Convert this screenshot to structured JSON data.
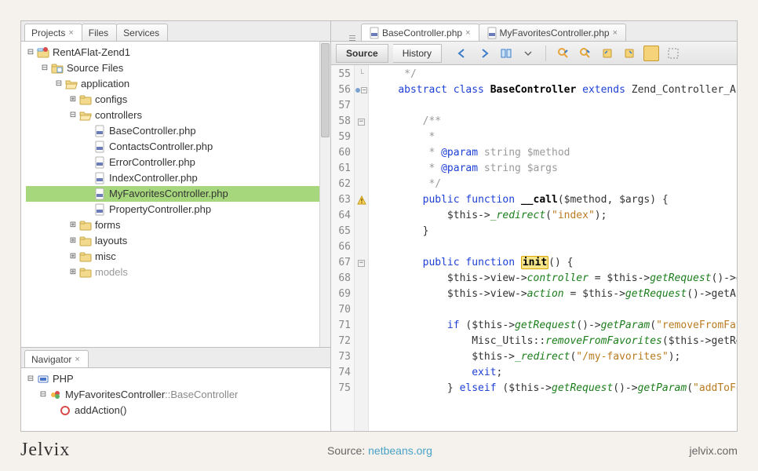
{
  "projects_panel": {
    "tabs": [
      {
        "label": "Projects",
        "active": true,
        "closable": true
      },
      {
        "label": "Files",
        "active": false,
        "closable": false
      },
      {
        "label": "Services",
        "active": false,
        "closable": false
      }
    ],
    "tree": [
      {
        "depth": 0,
        "expand": "minus",
        "icon": "project-icon",
        "label": "RentAFlat-Zend1"
      },
      {
        "depth": 1,
        "expand": "minus",
        "icon": "folder-source-icon",
        "label": "Source Files"
      },
      {
        "depth": 2,
        "expand": "minus",
        "icon": "folder-open-icon",
        "label": "application"
      },
      {
        "depth": 3,
        "expand": "plus",
        "icon": "folder-icon",
        "label": "configs"
      },
      {
        "depth": 3,
        "expand": "minus",
        "icon": "folder-open-icon",
        "label": "controllers"
      },
      {
        "depth": 4,
        "expand": "none",
        "icon": "php-file-icon",
        "label": "BaseController.php"
      },
      {
        "depth": 4,
        "expand": "none",
        "icon": "php-file-icon",
        "label": "ContactsController.php"
      },
      {
        "depth": 4,
        "expand": "none",
        "icon": "php-file-icon",
        "label": "ErrorController.php"
      },
      {
        "depth": 4,
        "expand": "none",
        "icon": "php-file-icon",
        "label": "IndexController.php"
      },
      {
        "depth": 4,
        "expand": "none",
        "icon": "php-file-icon",
        "label": "MyFavoritesController.php",
        "selected": true
      },
      {
        "depth": 4,
        "expand": "none",
        "icon": "php-file-icon",
        "label": "PropertyController.php"
      },
      {
        "depth": 3,
        "expand": "plus",
        "icon": "folder-icon",
        "label": "forms"
      },
      {
        "depth": 3,
        "expand": "plus",
        "icon": "folder-icon",
        "label": "layouts"
      },
      {
        "depth": 3,
        "expand": "plus",
        "icon": "folder-icon",
        "label": "misc"
      },
      {
        "depth": 3,
        "expand": "plus",
        "icon": "folder-icon",
        "label": "models",
        "cut": true
      }
    ]
  },
  "navigator_panel": {
    "tab_label": "Navigator",
    "root_label": "PHP",
    "class_name": "MyFavoritesController",
    "class_sep": "::",
    "class_base": "BaseController",
    "members": [
      "addAction()"
    ]
  },
  "editor": {
    "tabs": [
      {
        "icon": "php-file-icon",
        "label": "BaseController.php",
        "active": true
      },
      {
        "icon": "php-file-icon",
        "label": "MyFavoritesController.php",
        "active": false
      }
    ],
    "toolbar": {
      "source_label": "Source",
      "history_label": "History"
    },
    "line_start": 55,
    "glyphs": {
      "55": "fold-end",
      "56": "bullet-fold",
      "58": "fold-open",
      "63": "warning",
      "67": "fold-open"
    },
    "lines": [
      {
        "n": 55,
        "segs": [
          {
            "t": "     ",
            "c": ""
          },
          {
            "t": "*/",
            "c": "cm"
          }
        ]
      },
      {
        "n": 56,
        "segs": [
          {
            "t": "    ",
            "c": ""
          },
          {
            "t": "abstract class",
            "c": "kw"
          },
          {
            "t": " ",
            "c": ""
          },
          {
            "t": "BaseController",
            "c": "bold"
          },
          {
            "t": " ",
            "c": ""
          },
          {
            "t": "extends",
            "c": "kw"
          },
          {
            "t": " Zend_Controller_Ac",
            "c": ""
          }
        ]
      },
      {
        "n": 57,
        "segs": [
          {
            "t": " ",
            "c": ""
          }
        ]
      },
      {
        "n": 58,
        "segs": [
          {
            "t": "        ",
            "c": ""
          },
          {
            "t": "/**",
            "c": "cm"
          }
        ]
      },
      {
        "n": 59,
        "segs": [
          {
            "t": "         ",
            "c": ""
          },
          {
            "t": "*",
            "c": "cm"
          }
        ]
      },
      {
        "n": 60,
        "segs": [
          {
            "t": "         ",
            "c": ""
          },
          {
            "t": "* ",
            "c": "cm"
          },
          {
            "t": "@param",
            "c": "kw"
          },
          {
            "t": " string $method",
            "c": "cm"
          }
        ]
      },
      {
        "n": 61,
        "segs": [
          {
            "t": "         ",
            "c": ""
          },
          {
            "t": "* ",
            "c": "cm"
          },
          {
            "t": "@param",
            "c": "kw"
          },
          {
            "t": " string $args",
            "c": "cm"
          }
        ]
      },
      {
        "n": 62,
        "segs": [
          {
            "t": "         ",
            "c": ""
          },
          {
            "t": "*/",
            "c": "cm"
          }
        ]
      },
      {
        "n": 63,
        "segs": [
          {
            "t": "        ",
            "c": ""
          },
          {
            "t": "public function",
            "c": "kw"
          },
          {
            "t": " ",
            "c": ""
          },
          {
            "t": "__call",
            "c": "bold"
          },
          {
            "t": "($method, $args) {",
            "c": ""
          }
        ]
      },
      {
        "n": 64,
        "segs": [
          {
            "t": "            $this->",
            "c": ""
          },
          {
            "t": "_redirect",
            "c": "fn"
          },
          {
            "t": "(",
            "c": ""
          },
          {
            "t": "\"index\"",
            "c": "str"
          },
          {
            "t": ");",
            "c": ""
          }
        ]
      },
      {
        "n": 65,
        "segs": [
          {
            "t": "        }",
            "c": ""
          }
        ]
      },
      {
        "n": 66,
        "segs": [
          {
            "t": " ",
            "c": ""
          }
        ]
      },
      {
        "n": 67,
        "segs": [
          {
            "t": "        ",
            "c": ""
          },
          {
            "t": "public function",
            "c": "kw"
          },
          {
            "t": " ",
            "c": ""
          },
          {
            "t": "init",
            "c": "hl-word bold"
          },
          {
            "t": "() {",
            "c": ""
          }
        ]
      },
      {
        "n": 68,
        "segs": [
          {
            "t": "            $this->view->",
            "c": ""
          },
          {
            "t": "controller",
            "c": "fn"
          },
          {
            "t": " = $this->",
            "c": ""
          },
          {
            "t": "getRequest",
            "c": "fn"
          },
          {
            "t": "()->g",
            "c": ""
          }
        ]
      },
      {
        "n": 69,
        "segs": [
          {
            "t": "            $this->view->",
            "c": ""
          },
          {
            "t": "action",
            "c": "fn"
          },
          {
            "t": " = $this->",
            "c": ""
          },
          {
            "t": "getRequest",
            "c": "fn"
          },
          {
            "t": "()->getAc",
            "c": ""
          }
        ]
      },
      {
        "n": 70,
        "segs": [
          {
            "t": " ",
            "c": ""
          }
        ]
      },
      {
        "n": 71,
        "segs": [
          {
            "t": "            ",
            "c": ""
          },
          {
            "t": "if",
            "c": "kw"
          },
          {
            "t": " ($this->",
            "c": ""
          },
          {
            "t": "getRequest",
            "c": "fn"
          },
          {
            "t": "()->",
            "c": ""
          },
          {
            "t": "getParam",
            "c": "fn"
          },
          {
            "t": "(",
            "c": ""
          },
          {
            "t": "\"removeFromFav",
            "c": "str"
          }
        ]
      },
      {
        "n": 72,
        "segs": [
          {
            "t": "                Misc_Utils::",
            "c": ""
          },
          {
            "t": "removeFromFavorites",
            "c": "fn"
          },
          {
            "t": "($this->getRe",
            "c": ""
          }
        ]
      },
      {
        "n": 73,
        "segs": [
          {
            "t": "                $this->",
            "c": ""
          },
          {
            "t": "_redirect",
            "c": "fn"
          },
          {
            "t": "(",
            "c": ""
          },
          {
            "t": "\"/my-favorites\"",
            "c": "str"
          },
          {
            "t": ");",
            "c": ""
          }
        ]
      },
      {
        "n": 74,
        "segs": [
          {
            "t": "                ",
            "c": ""
          },
          {
            "t": "exit",
            "c": "kw"
          },
          {
            "t": ";",
            "c": ""
          }
        ]
      },
      {
        "n": 75,
        "segs": [
          {
            "t": "            } ",
            "c": ""
          },
          {
            "t": "elseif",
            "c": "kw"
          },
          {
            "t": " ($this->",
            "c": ""
          },
          {
            "t": "getRequest",
            "c": "fn"
          },
          {
            "t": "()->",
            "c": ""
          },
          {
            "t": "getParam",
            "c": "fn"
          },
          {
            "t": "(",
            "c": ""
          },
          {
            "t": "\"addToFa",
            "c": "str"
          }
        ]
      }
    ]
  },
  "footer": {
    "brand": "Jelvix",
    "source_prefix": "Source: ",
    "source_link": "netbeans.org",
    "site": "jelvix.com"
  }
}
